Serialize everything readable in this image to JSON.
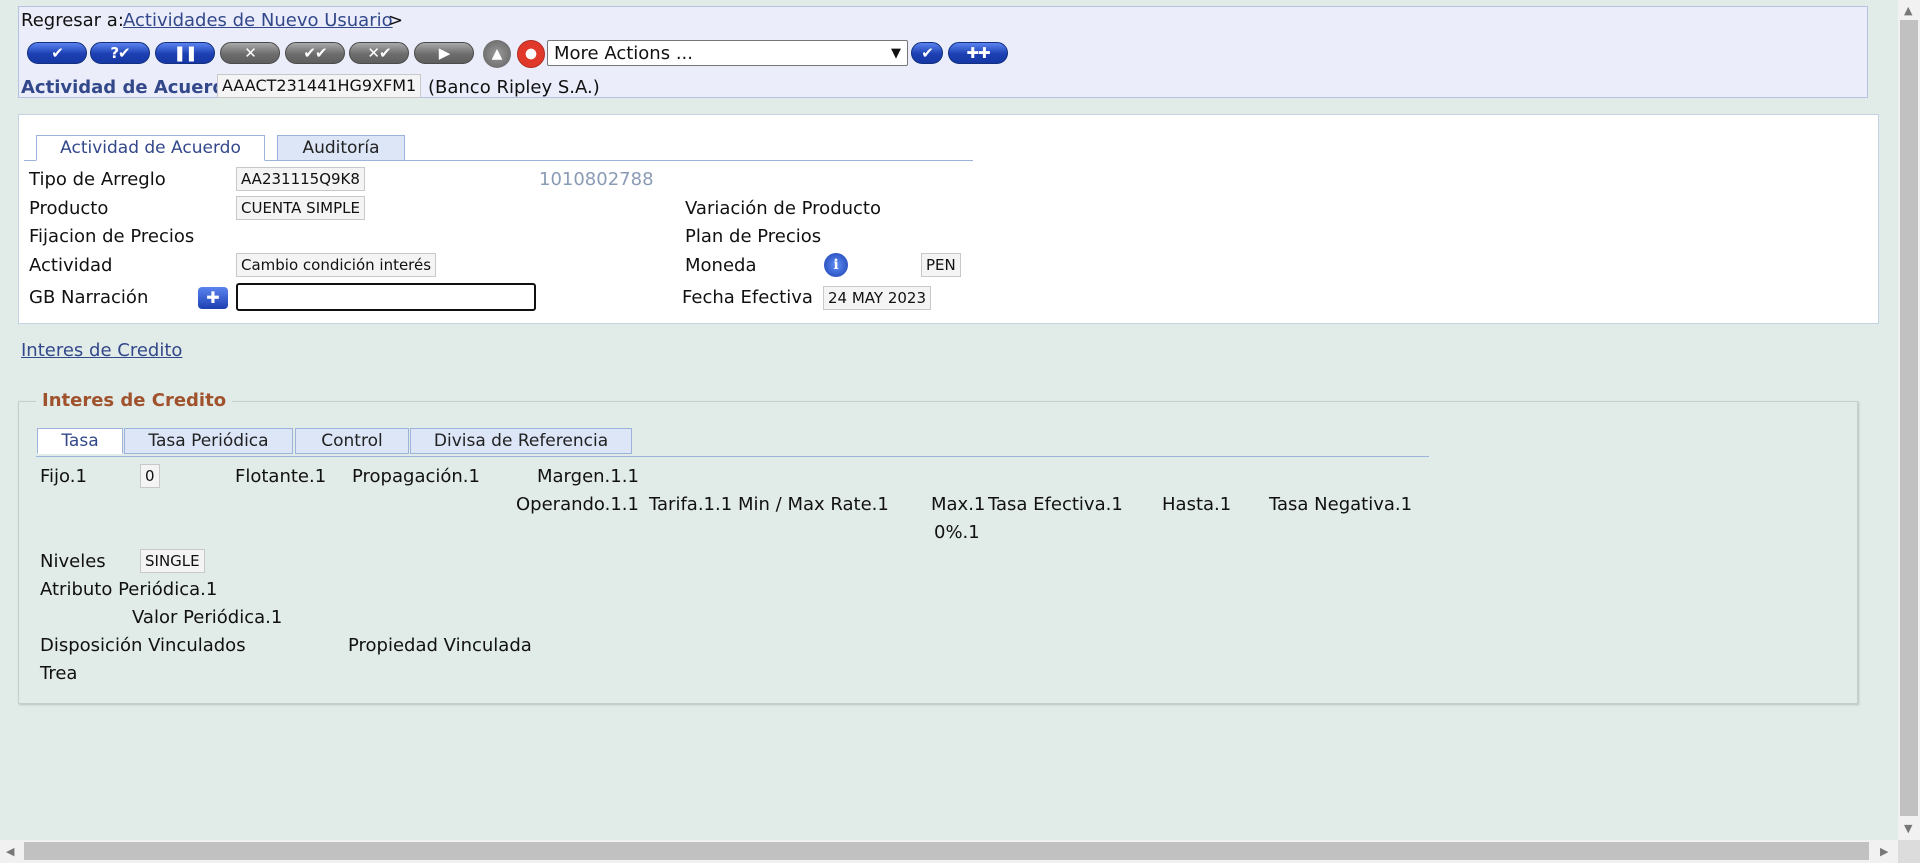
{
  "header": {
    "back_label": "Regresar a:",
    "back_link": "Actividades de Nuevo Usuario",
    "back_sep": ">",
    "record_label": "Actividad de Acuerdo",
    "record_id": "AAACT231441HG9XFM1",
    "record_name": "(Banco Ripley S.A.)"
  },
  "toolbar": {
    "more_actions": "More Actions ...",
    "buttons": [
      "commit",
      "validate",
      "hold",
      "delete",
      "authorise",
      "reverse",
      "next",
      "upload",
      "help",
      "go",
      "new-deal"
    ]
  },
  "tabs": [
    "Actividad de Acuerdo",
    "Auditoría"
  ],
  "form": {
    "tipo_arreglo_label": "Tipo de Arreglo",
    "tipo_arreglo_value": "AA231115Q9K8",
    "customer_number": "1010802788",
    "producto_label": "Producto",
    "producto_value": "CUENTA SIMPLE",
    "variacion_label": "Variación de Producto",
    "fijacion_label": "Fijacion de Precios",
    "plan_label": "Plan de Precios",
    "actividad_label": "Actividad",
    "actividad_value": "Cambio condición interés",
    "moneda_label": "Moneda",
    "moneda_value": "PEN",
    "gb_label": "GB Narración",
    "gb_value": "",
    "fecha_label": "Fecha Efectiva",
    "fecha_value": "24 MAY 2023"
  },
  "section_link": "Interes de Credito",
  "fieldset": {
    "legend": "Interes de Credito",
    "tabs": [
      "Tasa",
      "Tasa Periódica",
      "Control",
      "Divisa de Referencia"
    ],
    "fijo_label": "Fijo.1",
    "fijo_value": "0",
    "flotante_label": "Flotante.1",
    "propagacion_label": "Propagación.1",
    "margen_label": "Margen.1.1",
    "operando_label": "Operando.1.1",
    "tarifa_label": "Tarifa.1.1",
    "minmax_label": "Min / Max Rate.1",
    "max_label": "Max.1",
    "tasa_efectiva_label": "Tasa Efectiva.1",
    "hasta_label": "Hasta.1",
    "tasa_negativa_label": "Tasa Negativa.1",
    "pct_label": "0%.1",
    "niveles_label": "Niveles",
    "niveles_value": "SINGLE",
    "atributo_label": "Atributo Periódica.1",
    "valor_label": "Valor Periódica.1",
    "disposicion_label": "Disposición Vinculados",
    "propiedad_label": "Propiedad Vinculada",
    "trea_label": "Trea"
  },
  "colors": {
    "background": "#e1ebe8",
    "header_bg": "#ebeefa",
    "link": "#33488a",
    "legend": "#a0522d",
    "button_blue": "#1c3fb2",
    "button_gray": "#6d6d6d"
  }
}
